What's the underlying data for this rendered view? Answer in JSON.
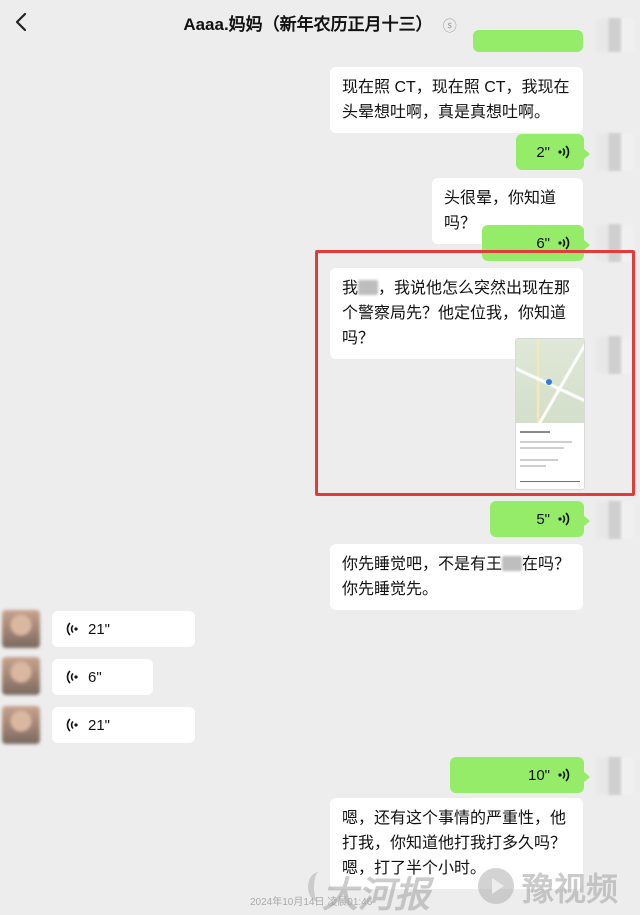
{
  "header": {
    "title": "Aaaa.妈妈（新年农历正月十三）",
    "mute_indicator": "ⓢ"
  },
  "messages": {
    "m1": "现在照 CT，现在照 CT，我现在头晕想吐啊，真是真想吐啊。",
    "m2_duration": "2\"",
    "m3": "头很晕，你知道吗？",
    "m4_duration": "6\"",
    "m5_a": "我",
    "m5_b": "，我说他怎么突然出现在那个警察局先？他定位我，你知道吗？",
    "m6_duration": "5\"",
    "m7_a": "你先睡觉吧，不是有王",
    "m7_b": "在吗？你先睡觉先。",
    "m8_duration": "21\"",
    "m9_duration": "6\"",
    "m10_duration": "21\"",
    "m11_duration": "10\"",
    "m12": "嗯，还有这个事情的严重性，他打我，你知道他打我打多久吗？嗯，打了半个小时。"
  },
  "timestamp": "2024年10月14日 凌晨01:46",
  "watermark": {
    "brand": "大河报",
    "video": "豫视频"
  },
  "icons": {
    "back": "chevron-left-icon",
    "more": "more-dots-icon",
    "voice": "voice-wave-icon"
  },
  "colors": {
    "sent_bubble": "#95ec69",
    "received_bubble": "#ffffff",
    "background": "#ededed",
    "highlight_border": "#e23b3b"
  }
}
